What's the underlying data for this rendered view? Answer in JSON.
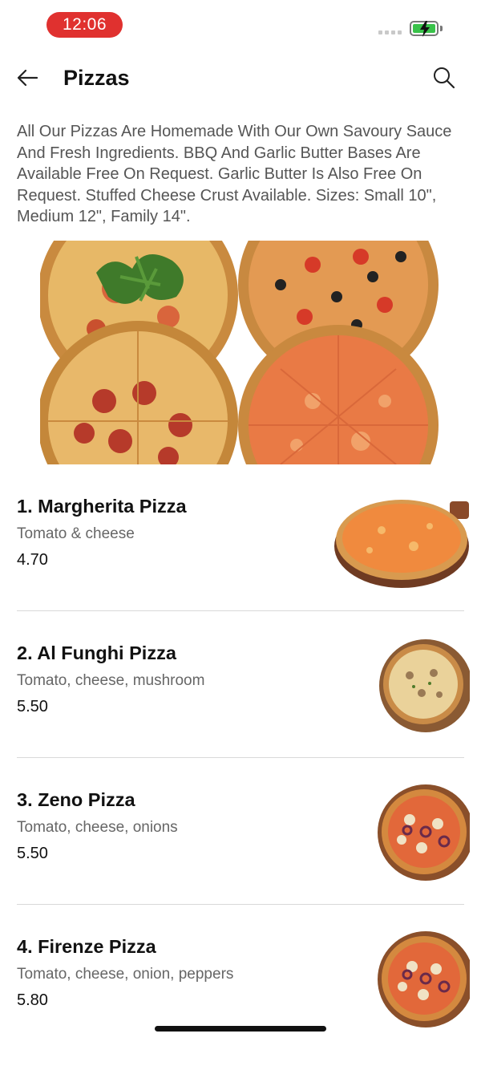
{
  "status_bar": {
    "time": "12:06",
    "time_pill_color": "#e0312f",
    "battery_color": "#39c24a"
  },
  "header": {
    "title": "Pizzas",
    "back_icon": "arrow-left-icon",
    "search_icon": "search-icon"
  },
  "description": "All Our Pizzas Are Homemade With Our Own Savoury Sauce And Fresh Ingredients. BBQ And Garlic Butter Bases Are Available Free On Request. Garlic Butter Is Also Free On Request. Stuffed Cheese Crust Available. Sizes: Small 10\", Medium 12\", Family 14\".",
  "menu": {
    "items": [
      {
        "name": "1. Margherita Pizza",
        "description": "Tomato  & cheese",
        "price": "4.70"
      },
      {
        "name": "2. Al Funghi Pizza",
        "description": "Tomato, cheese, mushroom",
        "price": "5.50"
      },
      {
        "name": "3. Zeno Pizza",
        "description": "Tomato, cheese, onions",
        "price": "5.50"
      },
      {
        "name": "4. Firenze Pizza",
        "description": "Tomato, cheese, onion, peppers",
        "price": "5.80"
      }
    ]
  }
}
